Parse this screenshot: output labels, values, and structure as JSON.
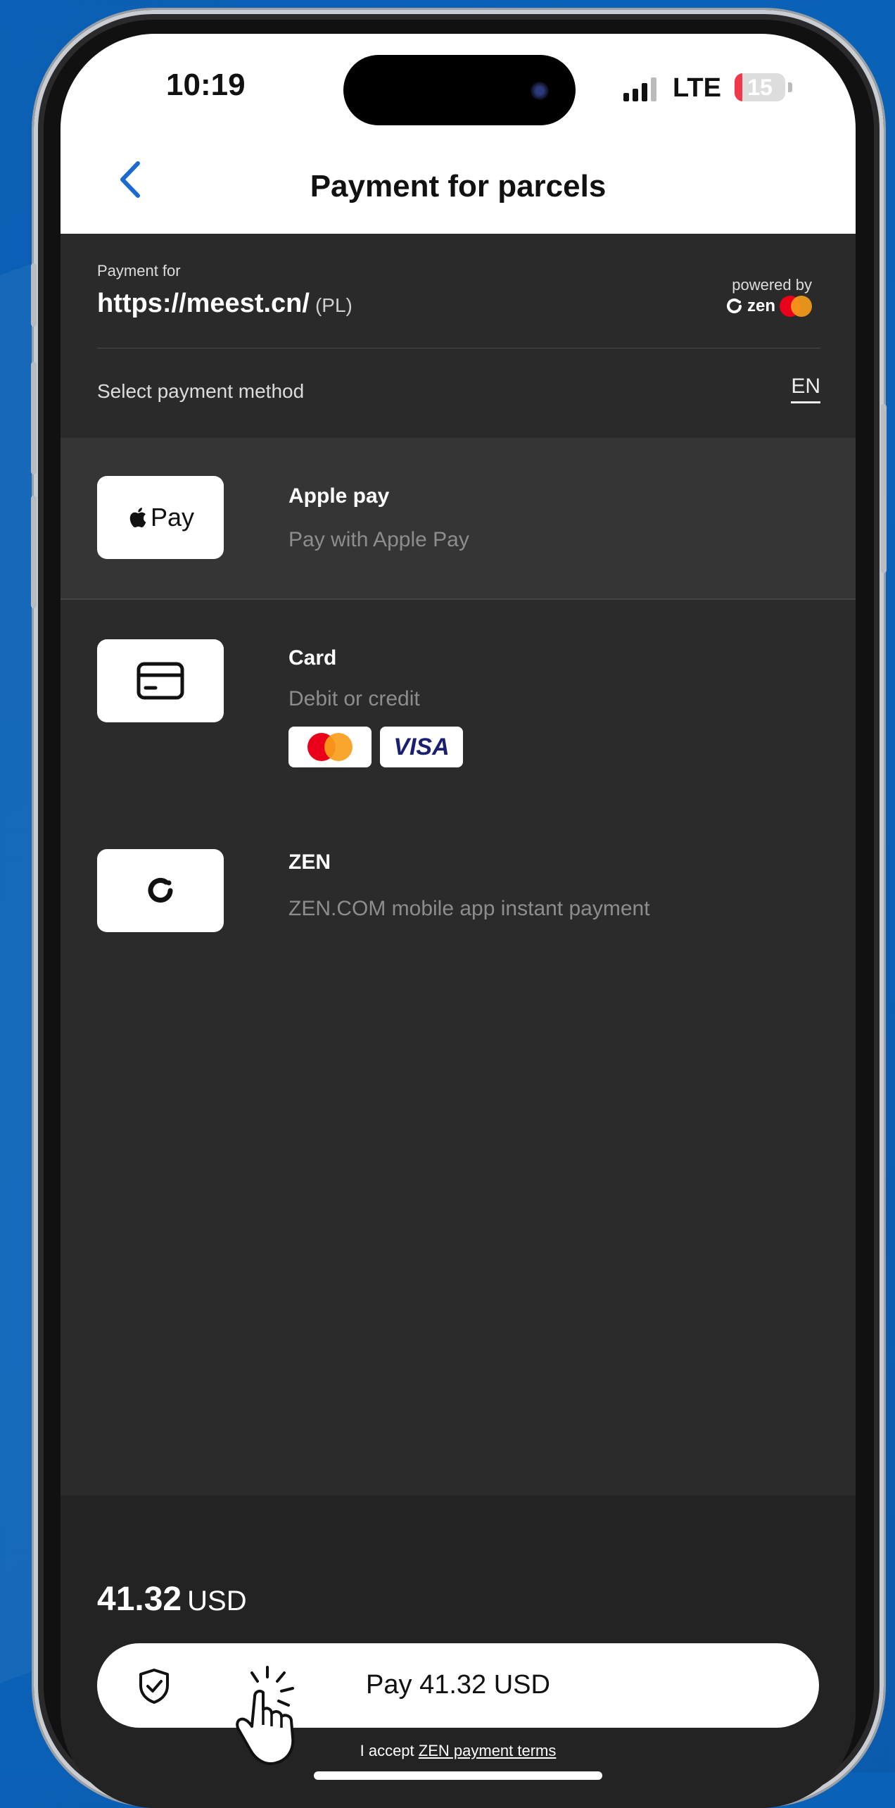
{
  "status_bar": {
    "time": "10:19",
    "network": "LTE",
    "battery_level": "15",
    "battery_fraction": 0.15
  },
  "nav": {
    "title": "Payment for parcels"
  },
  "merchant": {
    "payment_for_label": "Payment for",
    "url": "https://meest.cn/",
    "country": "(PL)",
    "powered_by": "powered by",
    "brand": "zen"
  },
  "method_header": {
    "label": "Select payment method",
    "language": "EN"
  },
  "methods": [
    {
      "title": "Apple pay",
      "subtitle": "Pay with Apple Pay",
      "tile_text": "Pay",
      "icon": "apple-pay-logo"
    },
    {
      "title": "Card",
      "subtitle": "Debit or credit",
      "icon": "credit-card-icon",
      "networks": [
        "mastercard",
        "VISA"
      ]
    },
    {
      "title": "ZEN",
      "subtitle": "ZEN.COM mobile app instant payment",
      "icon": "zen-logo-icon"
    }
  ],
  "footer": {
    "amount": "41.32",
    "currency": "USD",
    "pay_button": "Pay 41.32 USD",
    "terms_prefix": "I accept",
    "terms_link": "ZEN payment terms"
  },
  "colors": {
    "background": "#0b5fb4",
    "accent": "#1a6bd1",
    "mastercard_red": "#eb001b",
    "mastercard_orange": "#f79e1b",
    "visa_blue": "#1a1f71"
  }
}
